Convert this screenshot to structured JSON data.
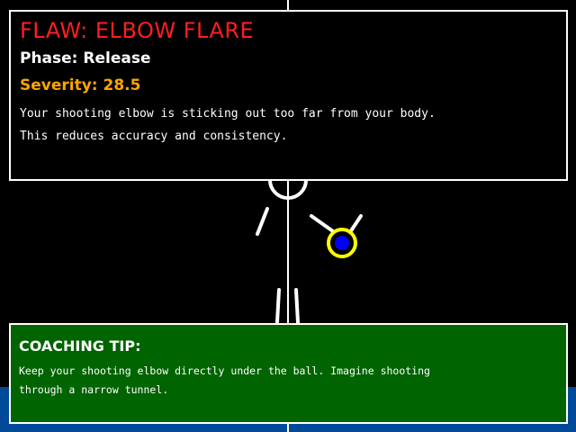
{
  "flaw_panel": {
    "title": "FLAW: ELBOW FLARE",
    "phase": "Phase: Release",
    "severity": "Severity: 28.5",
    "description": [
      "Your shooting elbow is sticking out too far from your body.",
      "This reduces accuracy and consistency."
    ]
  },
  "tip_panel": {
    "title": "COACHING TIP:",
    "lines": [
      "Keep your shooting elbow directly under the ball. Imagine shooting",
      "through a narrow tunnel."
    ]
  },
  "colors": {
    "background": "#000000",
    "court_floor": "#004a99",
    "flaw_title": "#ff1e1e",
    "severity": "#ffa500",
    "tip_panel": "#006400",
    "highlight_ring": "#ffff00",
    "ball": "#0000ff"
  }
}
